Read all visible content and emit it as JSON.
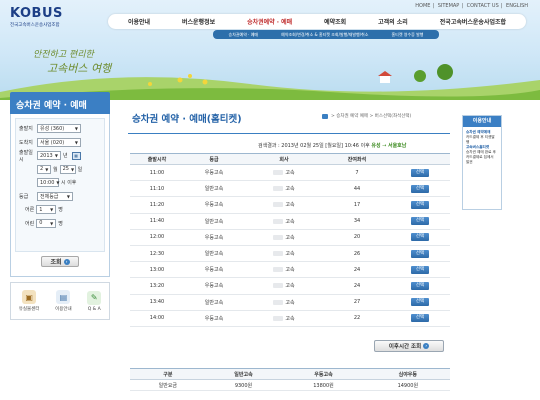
{
  "header": {
    "logo": "KOBUS",
    "logo_sub": "전국고속버스운송사업조합",
    "util_links": [
      "HOME",
      "SITEMAP",
      "CONTACT US",
      "ENGLISH"
    ],
    "gnb": [
      "이용안내",
      "버스운행정보",
      "승차권예약 · 예매",
      "예약조회",
      "고객의 소리",
      "전국고속버스운송사업조합"
    ],
    "gnb_active_index": 2,
    "lnb": [
      "승차권예약 · 예매",
      "예약조회/변경/취소 & 홈티켓 조회/발행/재발행/취소",
      "홈티켓 영수증 발행"
    ],
    "slogan_line1": "안전하고 편리한",
    "slogan_line2": "고속버스 여행"
  },
  "sidebar": {
    "title": "승차권 예약 · 예매",
    "fields": {
      "dep_label": "출발지",
      "dep_value": "유성 (360)",
      "arr_label": "도착지",
      "arr_value": "서울 (020)",
      "date_label": "출발일시",
      "year": "2013",
      "year_unit": "년",
      "month": "2",
      "month_unit": "월",
      "day": "25",
      "day_unit": "일",
      "hour": "10:00",
      "hour_unit": "시 이후",
      "grade_label": "등급",
      "grade_value": "전체등급",
      "adult_label": "어른",
      "adult_value": "1",
      "child_label": "어린",
      "child_value": "0",
      "count_unit": "명"
    },
    "search_label": "조회",
    "icons": [
      {
        "name": "유실물센터",
        "icon": "box-icon"
      },
      {
        "name": "이용안내",
        "icon": "clipboard-icon"
      },
      {
        "name": "Q & A",
        "icon": "qa-icon"
      }
    ]
  },
  "main": {
    "title": "승차권 예약 · 예매(홈티켓)",
    "breadcrumb": "> 승차권 예약 예매 > 버스선택(좌석선택)",
    "route_info": "검색결과 : 2013년 02월 25일 [월요일] 10:46 이후",
    "route_from": "유성",
    "route_arrow": "→",
    "route_to": "서울호남",
    "columns": [
      "출발시각",
      "등급",
      "회사",
      "잔여좌석",
      ""
    ],
    "rows": [
      {
        "time": "11:00",
        "grade": "우등고속",
        "company": "고속",
        "seats": "7",
        "btn": "선택"
      },
      {
        "time": "11:10",
        "grade": "일반고속",
        "company": "고속",
        "seats": "44",
        "btn": "선택"
      },
      {
        "time": "11:20",
        "grade": "우등고속",
        "company": "고속",
        "seats": "17",
        "btn": "선택"
      },
      {
        "time": "11:40",
        "grade": "일반고속",
        "company": "고속",
        "seats": "34",
        "btn": "선택"
      },
      {
        "time": "12:00",
        "grade": "우등고속",
        "company": "고속",
        "seats": "20",
        "btn": "선택"
      },
      {
        "time": "12:30",
        "grade": "일반고속",
        "company": "고속",
        "seats": "26",
        "btn": "선택"
      },
      {
        "time": "13:00",
        "grade": "우등고속",
        "company": "고속",
        "seats": "24",
        "btn": "선택"
      },
      {
        "time": "13:20",
        "grade": "우등고속",
        "company": "고속",
        "seats": "24",
        "btn": "선택"
      },
      {
        "time": "13:40",
        "grade": "일반고속",
        "company": "고속",
        "seats": "27",
        "btn": "선택"
      },
      {
        "time": "14:00",
        "grade": "우등고속",
        "company": "고속",
        "seats": "22",
        "btn": "선택"
      }
    ],
    "after_button": "이후시간 조회",
    "fare_columns": [
      "구분",
      "일반고속",
      "우등고속",
      "심야우등"
    ],
    "fare_row": [
      "일반요금",
      "9300원",
      "13800원",
      "14900원"
    ]
  },
  "right_box": {
    "title": "이용안내",
    "item1_title": "승차권 예약예매",
    "item1_text": "카드결제 후 티켓발행",
    "item2_title": "고속버스홈티켓",
    "item2_text": "승차권 예매 완료 후 카드결제로 집에서 발권"
  }
}
